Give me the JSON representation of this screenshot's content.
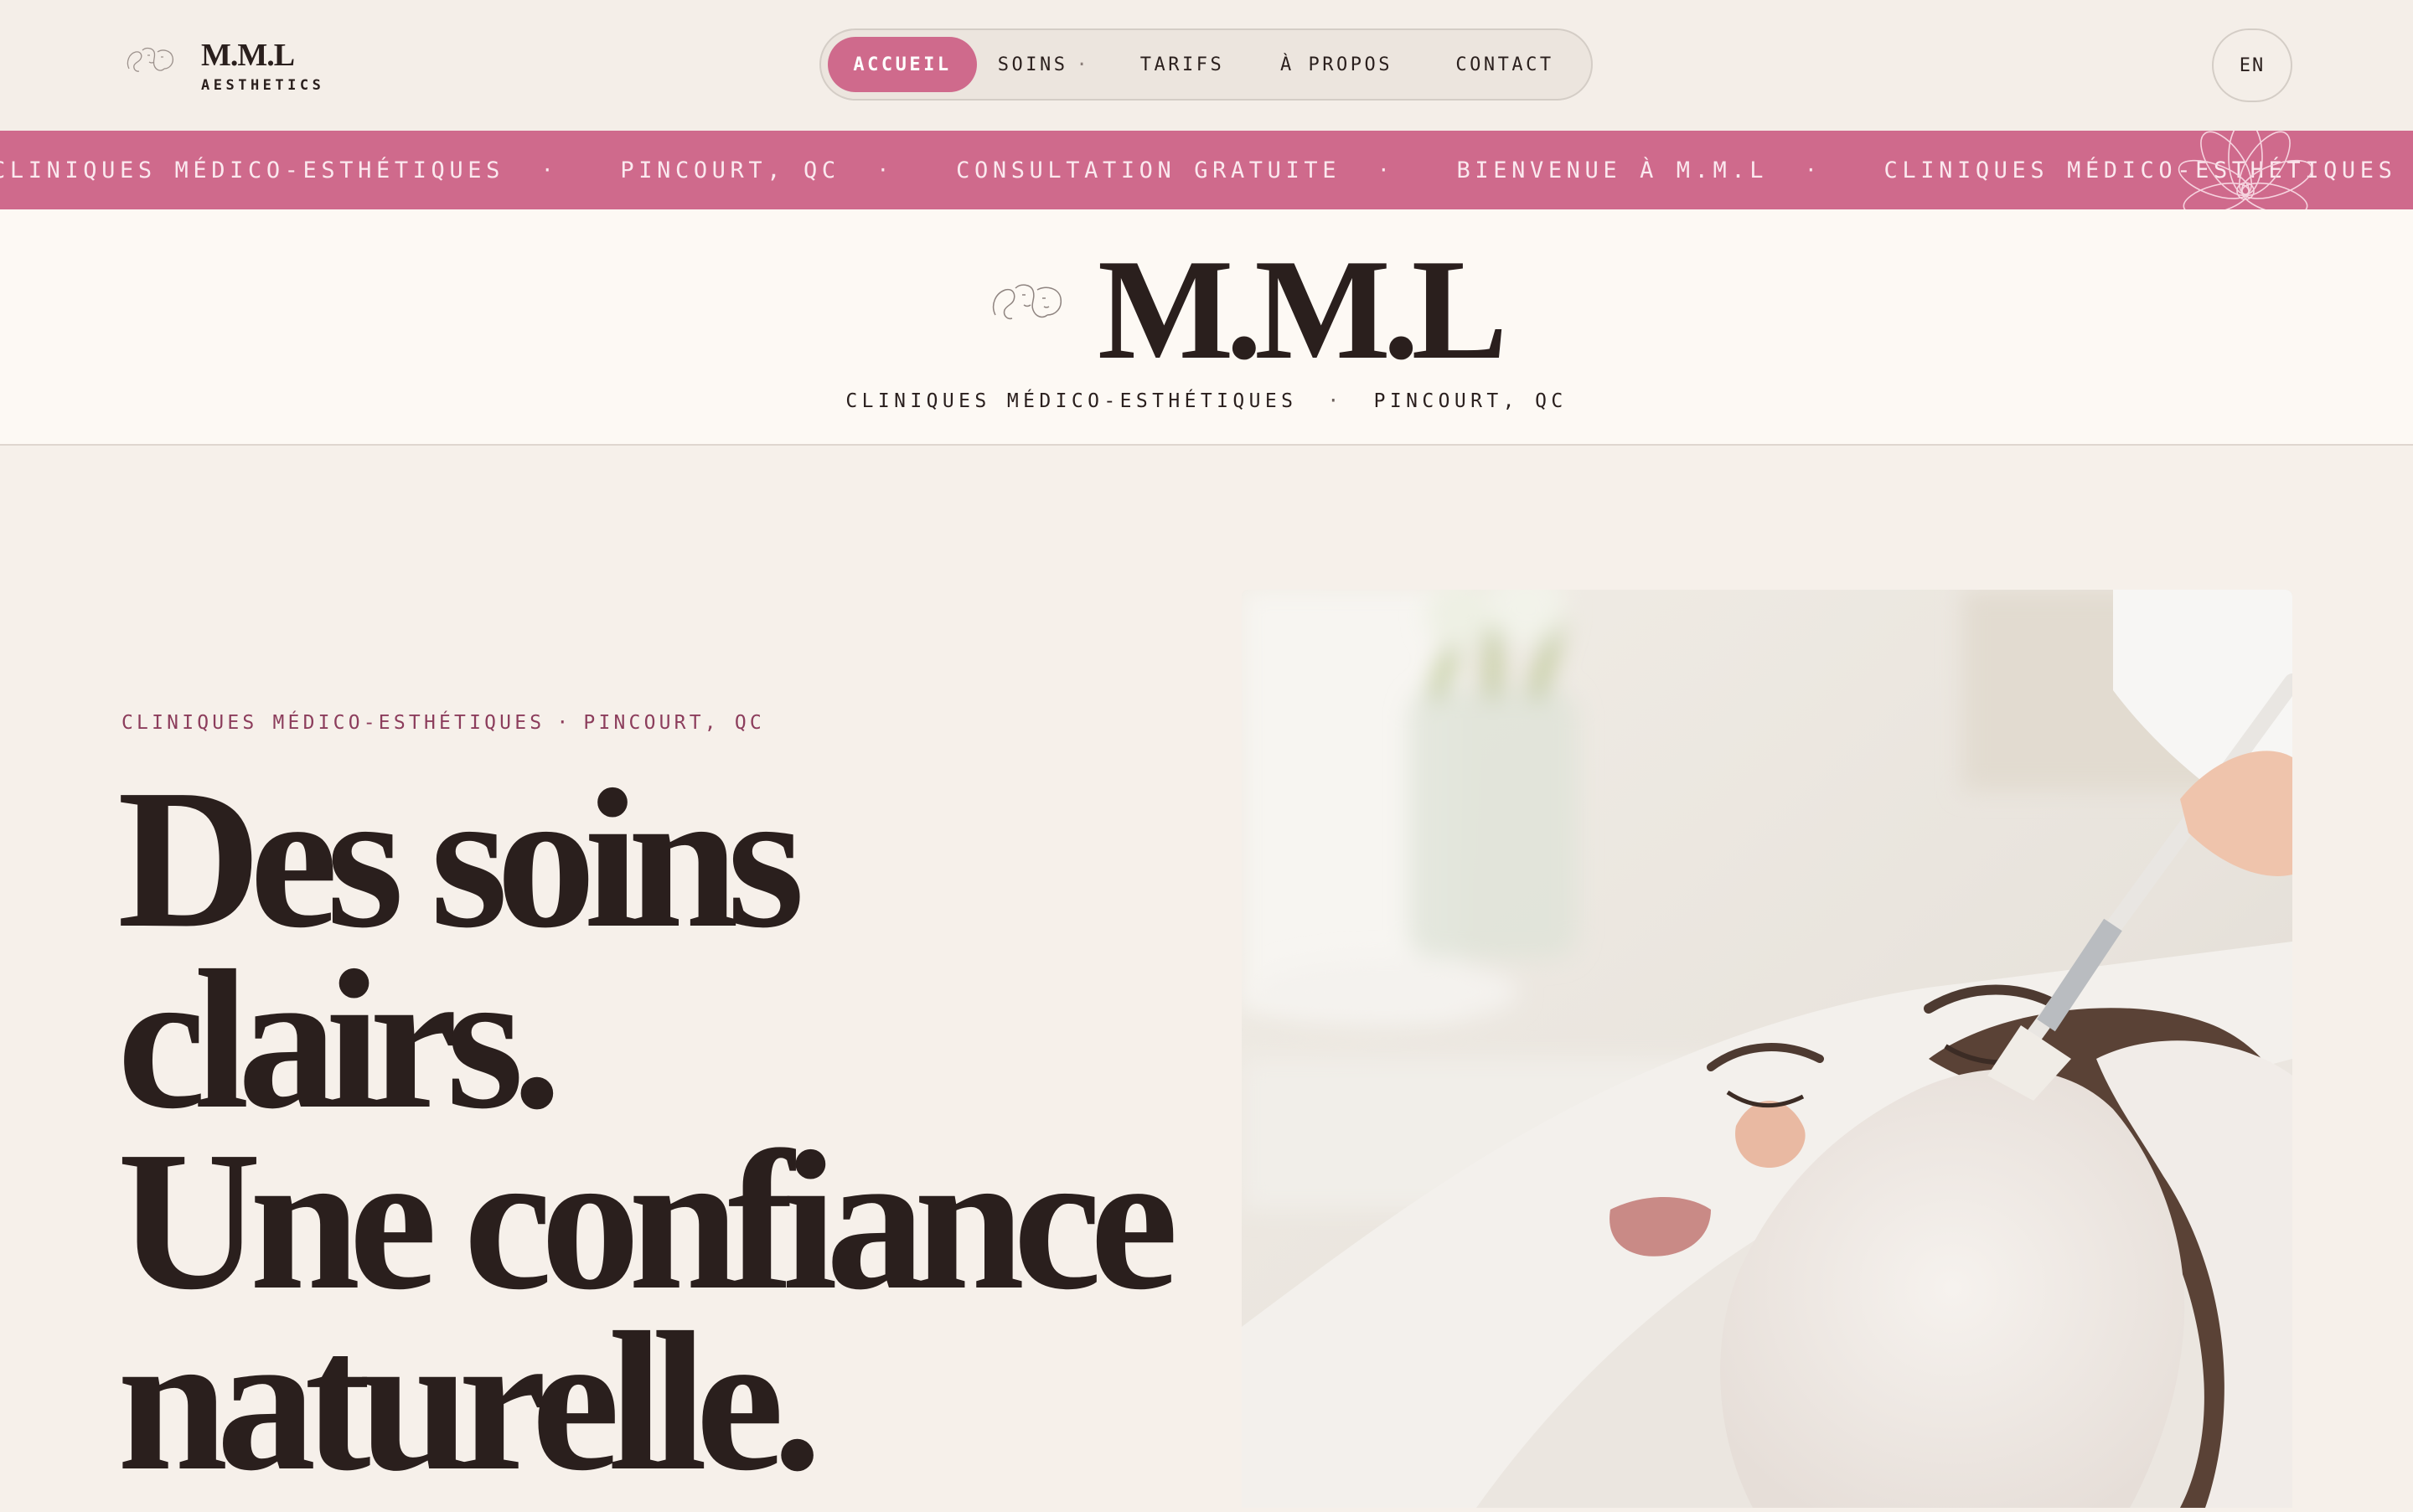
{
  "brand": {
    "name": "M.M.L",
    "tagline": "AESTHETICS",
    "logo_icon": "face-line-art-icon"
  },
  "nav": {
    "items": [
      {
        "label": "ACCUEIL",
        "active": true
      },
      {
        "label": "SOINS",
        "has_dropdown": true
      },
      {
        "label": "TARIFS"
      },
      {
        "label": "À PROPOS"
      },
      {
        "label": "CONTACT"
      }
    ],
    "dropdown_marker": "·",
    "language": "EN"
  },
  "band": {
    "items": [
      "CLINIQUES MÉDICO-ESTHÉTIQUES",
      "PINCOURT, QC",
      "CONSULTATION GRATUITE",
      "BIENVENUE À M.M.L",
      "CLINIQUES MÉDICO-ESTHÉTIQUES"
    ],
    "separator": "·"
  },
  "masthead": {
    "title": "M.M.L",
    "subtitle_left": "CLINIQUES MÉDICO-ESTHÉTIQUES",
    "subtitle_right": "PINCOURT, QC",
    "separator": "·"
  },
  "hero": {
    "eyebrow_left": "CLINIQUES MÉDICO-ESTHÉTIQUES",
    "eyebrow_right": "PINCOURT, QC",
    "eyebrow_separator": "·",
    "title_lines": [
      "Des soins",
      "clairs.",
      "Une confiance",
      "naturelle."
    ]
  },
  "colors": {
    "accent": "#cf6a8c",
    "background": "#f6f0ea",
    "masthead_bg": "#fdf9f4",
    "text": "#2a1f1d",
    "eyebrow": "#8c3d5c"
  }
}
